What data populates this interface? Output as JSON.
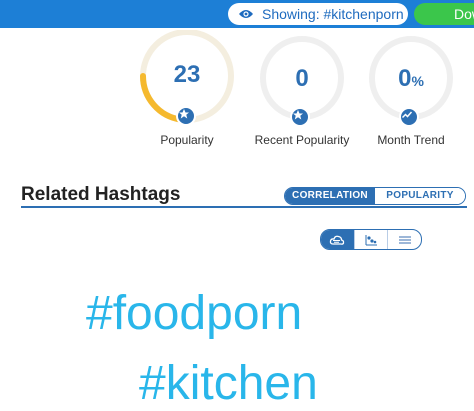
{
  "topbar": {
    "showing_text": "Showing: #kitchenporn",
    "download_label": "Download"
  },
  "stats": [
    {
      "value": "23",
      "label": "Popularity",
      "icon": "star-icon",
      "fill_fraction": 0.33
    },
    {
      "value": "0",
      "label": "Recent Popularity",
      "icon": "star-icon",
      "fill_fraction": 0
    },
    {
      "value": "0",
      "unit": "%",
      "label": "Month Trend",
      "icon": "trend-icon",
      "fill_fraction": 0
    }
  ],
  "related": {
    "title": "Related Hashtags",
    "sort_tabs": [
      {
        "label": "CORRELATION",
        "active": true
      },
      {
        "label": "POPULARITY",
        "active": false
      }
    ],
    "view_modes": [
      {
        "icon": "cloud-icon",
        "active": true
      },
      {
        "icon": "scatter-icon",
        "active": false
      },
      {
        "icon": "list-icon",
        "active": false
      }
    ],
    "tags": [
      "#foodporn",
      "#kitchen"
    ]
  },
  "colors": {
    "accent": "#2d6fb3",
    "topbar": "#1d7fd6",
    "gauge_fill": "#f5b92e",
    "gauge_track": "#f4eedf",
    "tag_color": "#29b6ea",
    "download_green": "#3bc64b"
  }
}
